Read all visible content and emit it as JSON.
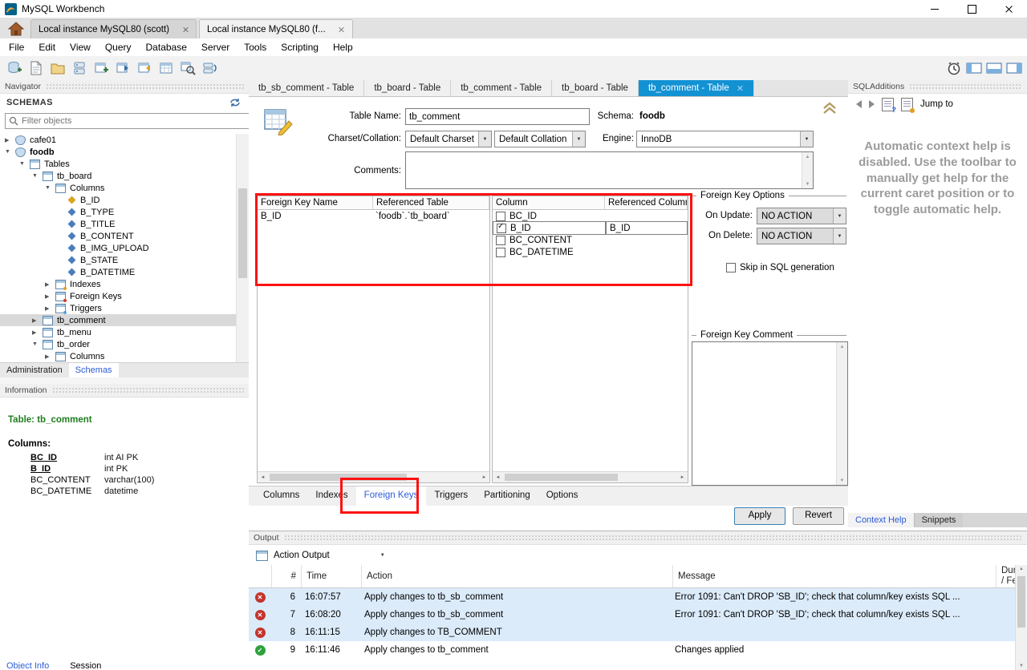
{
  "colors": {
    "accent_blue": "#1392d3",
    "annotation_red": "#ff1111",
    "error_red": "#c4342c",
    "success_green": "#2fa13c",
    "info_green": "#1e7e1e",
    "link_blue": "#2a5bd7",
    "help_gray": "#9b9b9b"
  },
  "icons": {
    "mysql-logo-icon": "dolphin-swoosh",
    "home-icon": "house",
    "search-icon": "magnifier",
    "refresh-icon": "circular-arrows",
    "close-icon": "x",
    "minimize-icon": "underscore",
    "maximize-icon": "square",
    "dropdown-arrow-icon": "▼",
    "expander-collapsed-icon": "▶",
    "expander-expanded-icon": "▼",
    "error-icon": "red-circle-x",
    "success-icon": "green-circle-check",
    "collapse-panel-icon": "double-chevron-up",
    "back-icon": "◄",
    "forward-icon": "►",
    "alarm-icon": "clock",
    "panel-toggle-icons": "blue-rect-sections"
  },
  "titlebar": {
    "app_title": "MySQL Workbench"
  },
  "connection_tabs": {
    "tab1": "Local instance MySQL80 (scott)",
    "tab2": "Local instance MySQL80 (f..."
  },
  "menubar": {
    "items": [
      "File",
      "Edit",
      "View",
      "Query",
      "Database",
      "Server",
      "Tools",
      "Scripting",
      "Help"
    ]
  },
  "navigator": {
    "header": "Navigator",
    "schemas_label": "SCHEMAS",
    "filter_placeholder": "Filter objects",
    "tree": [
      {
        "label": "cafe01"
      },
      {
        "label": "foodb"
      },
      {
        "label": "Tables"
      },
      {
        "label": "tb_board"
      },
      {
        "label": "Columns"
      },
      {
        "label": "B_ID"
      },
      {
        "label": "B_TYPE"
      },
      {
        "label": "B_TITLE"
      },
      {
        "label": "B_CONTENT"
      },
      {
        "label": "B_IMG_UPLOAD"
      },
      {
        "label": "B_STATE"
      },
      {
        "label": "B_DATETIME"
      },
      {
        "label": "Indexes"
      },
      {
        "label": "Foreign Keys"
      },
      {
        "label": "Triggers"
      },
      {
        "label": "tb_comment"
      },
      {
        "label": "tb_menu"
      },
      {
        "label": "tb_order"
      },
      {
        "label": "Columns"
      }
    ],
    "panel_tabs": {
      "administration": "Administration",
      "schemas": "Schemas"
    },
    "information": {
      "header": "Information",
      "table_label": "Table:",
      "table_name": "tb_comment",
      "columns_label": "Columns:",
      "columns": [
        {
          "name": "BC_ID",
          "type": "int AI PK"
        },
        {
          "name": "B_ID",
          "type": "int PK"
        },
        {
          "name": "BC_CONTENT",
          "type": "varchar(100)"
        },
        {
          "name": "BC_DATETIME",
          "type": "datetime"
        }
      ]
    },
    "footer_tabs": {
      "object_info": "Object Info",
      "session": "Session"
    }
  },
  "editor": {
    "tabs": [
      {
        "label": "tb_sb_comment - Table"
      },
      {
        "label": "tb_board - Table"
      },
      {
        "label": "tb_comment - Table"
      },
      {
        "label": "tb_board - Table"
      },
      {
        "label": "tb_comment - Table"
      }
    ],
    "form": {
      "table_name_label": "Table Name:",
      "table_name_value": "tb_comment",
      "schema_label": "Schema:",
      "schema_value": "foodb",
      "charset_label": "Charset/Collation:",
      "charset_value": "Default Charset",
      "collation_value": "Default Collation",
      "engine_label": "Engine:",
      "engine_value": "InnoDB",
      "comments_label": "Comments:"
    },
    "fk_list": {
      "headers": {
        "name": "Foreign Key Name",
        "ref_table": "Referenced Table"
      },
      "rows": [
        {
          "name": "B_ID",
          "ref_table": "`foodb`.`tb_board`"
        }
      ]
    },
    "fk_columns": {
      "headers": {
        "column": "Column",
        "ref_column": "Referenced Column"
      },
      "rows": [
        {
          "column": "BC_ID",
          "checked": false,
          "ref_column": ""
        },
        {
          "column": "B_ID",
          "checked": true,
          "ref_column": "B_ID"
        },
        {
          "column": "BC_CONTENT",
          "checked": false,
          "ref_column": ""
        },
        {
          "column": "BC_DATETIME",
          "checked": false,
          "ref_column": ""
        }
      ]
    },
    "fk_options": {
      "legend": "Foreign Key Options",
      "on_update_label": "On Update:",
      "on_update_value": "NO ACTION",
      "on_delete_label": "On Delete:",
      "on_delete_value": "NO ACTION",
      "skip_label": "Skip in SQL generation"
    },
    "fk_comment_legend": "Foreign Key Comment",
    "bottom_tabs": [
      "Columns",
      "Indexes",
      "Foreign Keys",
      "Triggers",
      "Partitioning",
      "Options"
    ],
    "apply_label": "Apply",
    "revert_label": "Revert"
  },
  "sql_additions": {
    "header": "SQLAdditions",
    "jump_to_label": "Jump to",
    "help_text": "Automatic context help is disabled. Use the toolbar to manually get help for the current caret position or to toggle automatic help.",
    "tabs": {
      "context_help": "Context Help",
      "snippets": "Snippets"
    }
  },
  "output": {
    "header": "Output",
    "view_label": "Action Output",
    "columns": {
      "num": "#",
      "time": "Time",
      "action": "Action",
      "message": "Message",
      "duration": "Duration\n/ Fetch"
    },
    "rows": [
      {
        "status": "error",
        "num": "6",
        "time": "16:07:57",
        "action": "Apply changes to tb_sb_comment",
        "message": "Error 1091: Can't DROP 'SB_ID'; check that column/key exists SQL ...",
        "selected": true
      },
      {
        "status": "error",
        "num": "7",
        "time": "16:08:20",
        "action": "Apply changes to tb_sb_comment",
        "message": "Error 1091: Can't DROP 'SB_ID'; check that column/key exists SQL ...",
        "selected": true
      },
      {
        "status": "error",
        "num": "8",
        "time": "16:11:15",
        "action": "Apply changes to TB_COMMENT",
        "message": "",
        "selected": true
      },
      {
        "status": "success",
        "num": "9",
        "time": "16:11:46",
        "action": "Apply changes to tb_comment",
        "message": "Changes applied",
        "selected": false
      }
    ]
  }
}
